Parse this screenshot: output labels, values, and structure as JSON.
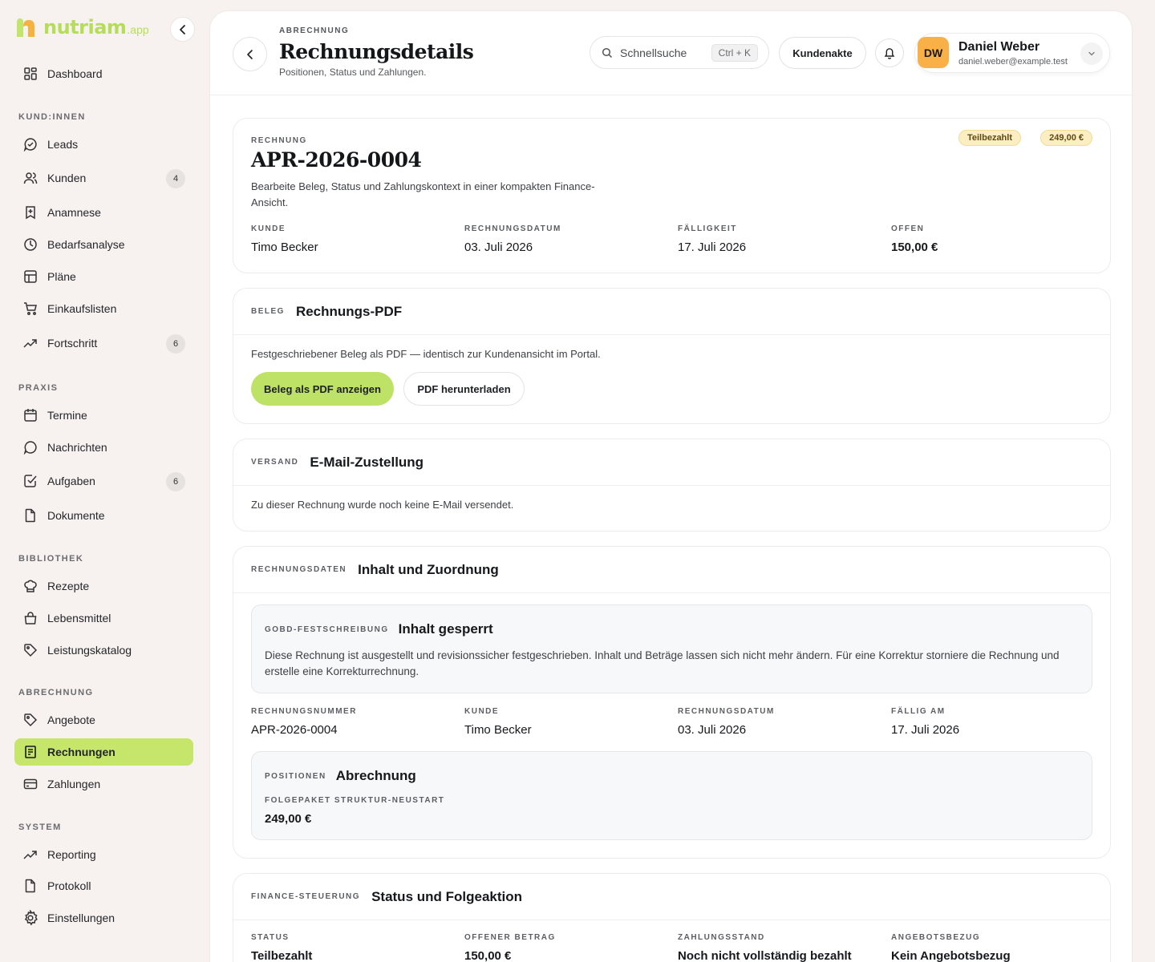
{
  "brand": {
    "name": "nutriam",
    "suffix": ".app",
    "color": "#b6dd5a"
  },
  "sidebar": {
    "sections": {
      "customers": "KUND:INNEN",
      "practice": "PRAXIS",
      "library": "BIBLIOTHEK",
      "billing": "ABRECHNUNG",
      "system": "SYSTEM"
    },
    "items": {
      "dashboard": "Dashboard",
      "leads": "Leads",
      "kunden": "Kunden",
      "kunden_badge": "4",
      "anamnese": "Anamnese",
      "bedarfsanalyse": "Bedarfsanalyse",
      "plaene": "Pläne",
      "einkaufslisten": "Einkaufslisten",
      "fortschritt": "Fortschritt",
      "fortschritt_badge": "6",
      "termine": "Termine",
      "nachrichten": "Nachrichten",
      "aufgaben": "Aufgaben",
      "aufgaben_badge": "6",
      "dokumente": "Dokumente",
      "rezepte": "Rezepte",
      "lebensmittel": "Lebensmittel",
      "leistungskatalog": "Leistungskatalog",
      "angebote": "Angebote",
      "rechnungen": "Rechnungen",
      "zahlungen": "Zahlungen",
      "reporting": "Reporting",
      "protokoll": "Protokoll",
      "einstellungen": "Einstellungen"
    }
  },
  "header": {
    "eyebrow": "ABRECHNUNG",
    "title": "Rechnungsdetails",
    "subtitle": "Positionen, Status und Zahlungen.",
    "search_placeholder": "Schnellsuche",
    "search_shortcut": "Ctrl + K",
    "customer_file_button": "Kundenakte",
    "user": {
      "initials": "DW",
      "name": "Daniel Weber",
      "email": "daniel.weber@example.test"
    }
  },
  "invoice": {
    "eyebrow": "RECHNUNG",
    "number": "APR-2026-0004",
    "description": "Bearbeite Beleg, Status und Zahlungskontext in einer kompakten Finance-Ansicht.",
    "status_badge": "Teilbezahlt",
    "amount_badge": "249,00 €",
    "fields": [
      {
        "label": "KUNDE",
        "value": "Timo Becker"
      },
      {
        "label": "RECHNUNGSDATUM",
        "value": "03. Juli 2026"
      },
      {
        "label": "FÄLLIGKEIT",
        "value": "17. Juli 2026"
      },
      {
        "label": "OFFEN",
        "value": "150,00 €"
      }
    ]
  },
  "document": {
    "eyebrow": "BELEG",
    "title": "Rechnungs-PDF",
    "text": "Festgeschriebener Beleg als PDF — identisch zur Kundenansicht im Portal.",
    "view_button": "Beleg als PDF anzeigen",
    "download_button": "PDF herunterladen"
  },
  "shipping": {
    "eyebrow": "VERSAND",
    "title": "E-Mail-Zustellung",
    "text": "Zu dieser Rechnung wurde noch keine E-Mail versendet."
  },
  "data_section": {
    "eyebrow": "RECHNUNGSDATEN",
    "title": "Inhalt und Zuordnung",
    "lock": {
      "eyebrow": "GOBD-FESTSCHREIBUNG",
      "title": "Inhalt gesperrt",
      "text": "Diese Rechnung ist ausgestellt und revisionssicher festgeschrieben. Inhalt und Beträge lassen sich nicht mehr ändern. Für eine Korrektur storniere die Rechnung und erstelle eine Korrekturrechnung."
    },
    "fields": [
      {
        "label": "RECHNUNGSNUMMER",
        "value": "APR-2026-0004"
      },
      {
        "label": "KUNDE",
        "value": "Timo Becker"
      },
      {
        "label": "RECHNUNGSDATUM",
        "value": "03. Juli 2026"
      },
      {
        "label": "FÄLLIG AM",
        "value": "17. Juli 2026"
      }
    ],
    "positions": {
      "eyebrow": "POSITIONEN",
      "title": "Abrechnung",
      "item_label": "FOLGEPAKET STRUKTUR-NEUSTART",
      "item_value": "249,00 €"
    }
  },
  "finance": {
    "eyebrow": "FINANCE-STEUERUNG",
    "title": "Status und Folgeaktion",
    "fields": [
      {
        "label": "STATUS",
        "value": "Teilbezahlt"
      },
      {
        "label": "OFFENER BETRAG",
        "value": "150,00 €"
      },
      {
        "label": "ZAHLUNGSSTAND",
        "value": "Noch nicht vollständig bezahlt"
      },
      {
        "label": "ANGEBOTSBEZUG",
        "value": "Kein Angebotsbezug"
      }
    ]
  },
  "colors": {
    "accent": "#c5e66b",
    "avatar": "#f9b046",
    "badge": "#fbeec2"
  }
}
